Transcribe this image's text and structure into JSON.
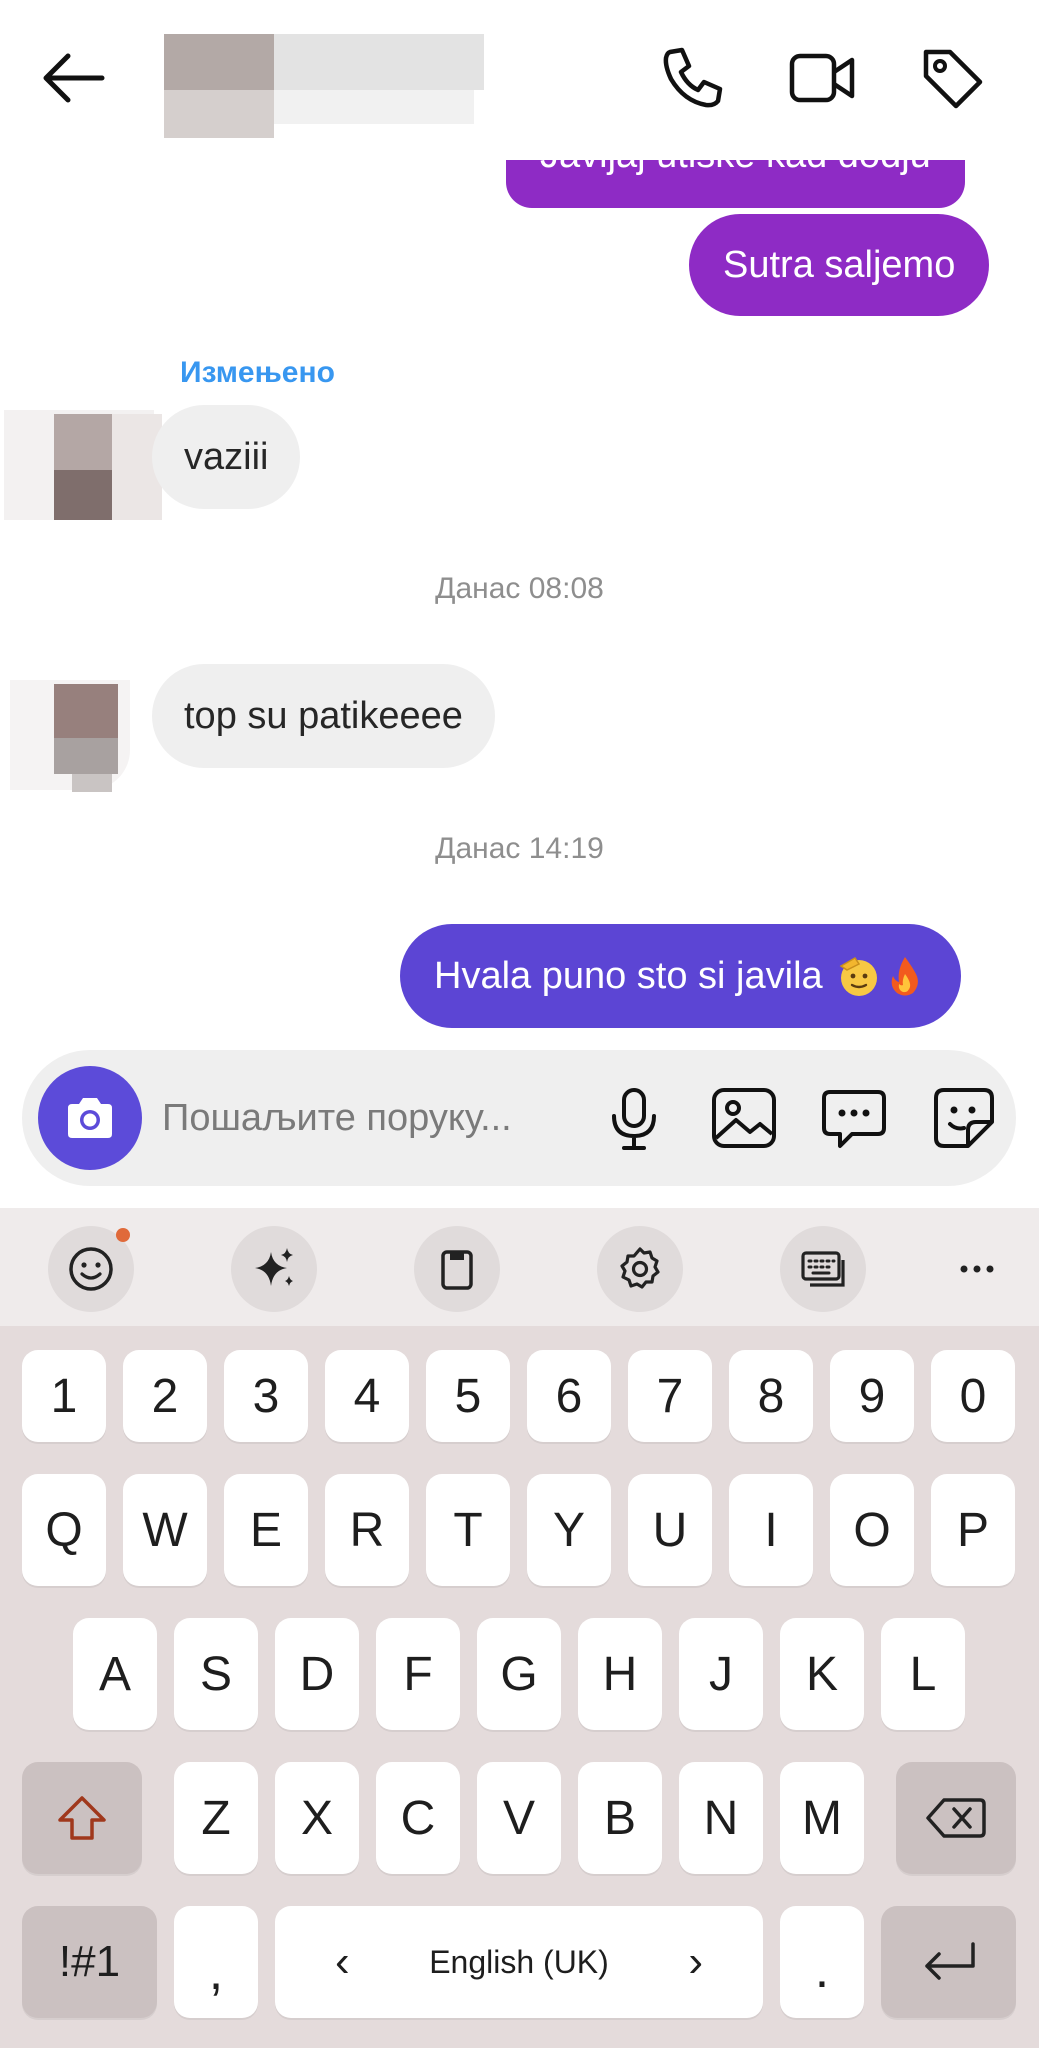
{
  "header": {
    "back_icon": "arrow-left-icon",
    "contact_name": "",
    "actions": [
      "phone-icon",
      "video-camera-icon",
      "tag-icon"
    ]
  },
  "messages": {
    "out_partial": "Javljaj utiske kad dodju",
    "out_1": "Sutra saljemo",
    "edited_label": "Измењено",
    "in_1": "vaziii",
    "timestamp_1": "Данас 08:08",
    "in_2": "top su patikeeee",
    "timestamp_2": "Данас 14:19",
    "out_2": "Hvala puno sto si javila",
    "out_2_emoji": [
      "saluting-face",
      "fire"
    ]
  },
  "composer": {
    "placeholder": "Пошаљите поруку...",
    "icons": [
      "camera-icon",
      "microphone-icon",
      "image-icon",
      "chat-bubble-icon",
      "sticker-icon"
    ]
  },
  "keyboard": {
    "toolbar": [
      "emoji-icon",
      "sparkles-icon",
      "clipboard-icon",
      "settings-icon",
      "keyboard-icon",
      "more-icon"
    ],
    "row_numbers": [
      "1",
      "2",
      "3",
      "4",
      "5",
      "6",
      "7",
      "8",
      "9",
      "0"
    ],
    "row_1": [
      "Q",
      "W",
      "E",
      "R",
      "T",
      "Y",
      "U",
      "I",
      "O",
      "P"
    ],
    "row_2": [
      "A",
      "S",
      "D",
      "F",
      "G",
      "H",
      "J",
      "K",
      "L"
    ],
    "row_3": [
      "Z",
      "X",
      "C",
      "V",
      "B",
      "N",
      "M"
    ],
    "symbols_label": "!#1",
    "comma_label": ",",
    "space_label": "English (UK)",
    "space_left": "‹",
    "space_right": "›",
    "period_label": "."
  },
  "colors": {
    "bubble_purple": "#8e2bc5",
    "bubble_indigo": "#5c45d4",
    "composer_accent": "#5c4bd9",
    "edited_blue": "#3897f0"
  }
}
